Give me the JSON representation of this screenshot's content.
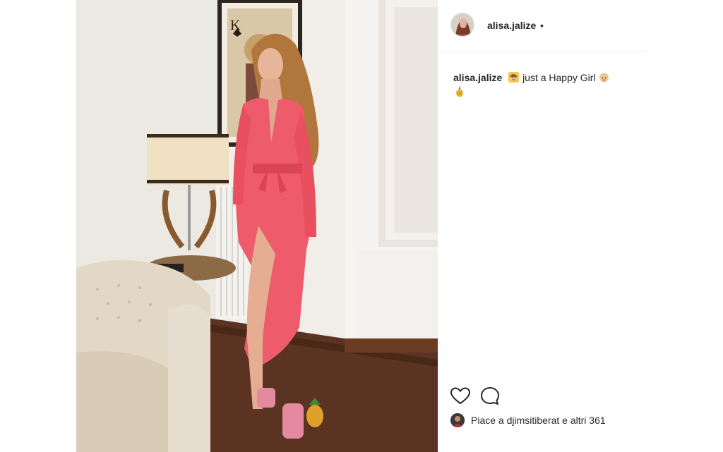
{
  "post": {
    "username": "alisa.jalize",
    "header_separator": "•",
    "caption_user": "alisa.jalize",
    "caption_text": "just a Happy Girl",
    "likes_text": "Piace a djimsitiberat e altri 361"
  },
  "icons": {
    "caption_emoji_1": "girl-face-emoji",
    "caption_emoji_2": "girl-face-emoji",
    "caption_emoji_3": "pineapple-emoji",
    "like": "heart-outline-icon",
    "comment": "comment-bubble-icon"
  },
  "colors": {
    "dress": "#ee5b6b",
    "text": "#262626"
  }
}
